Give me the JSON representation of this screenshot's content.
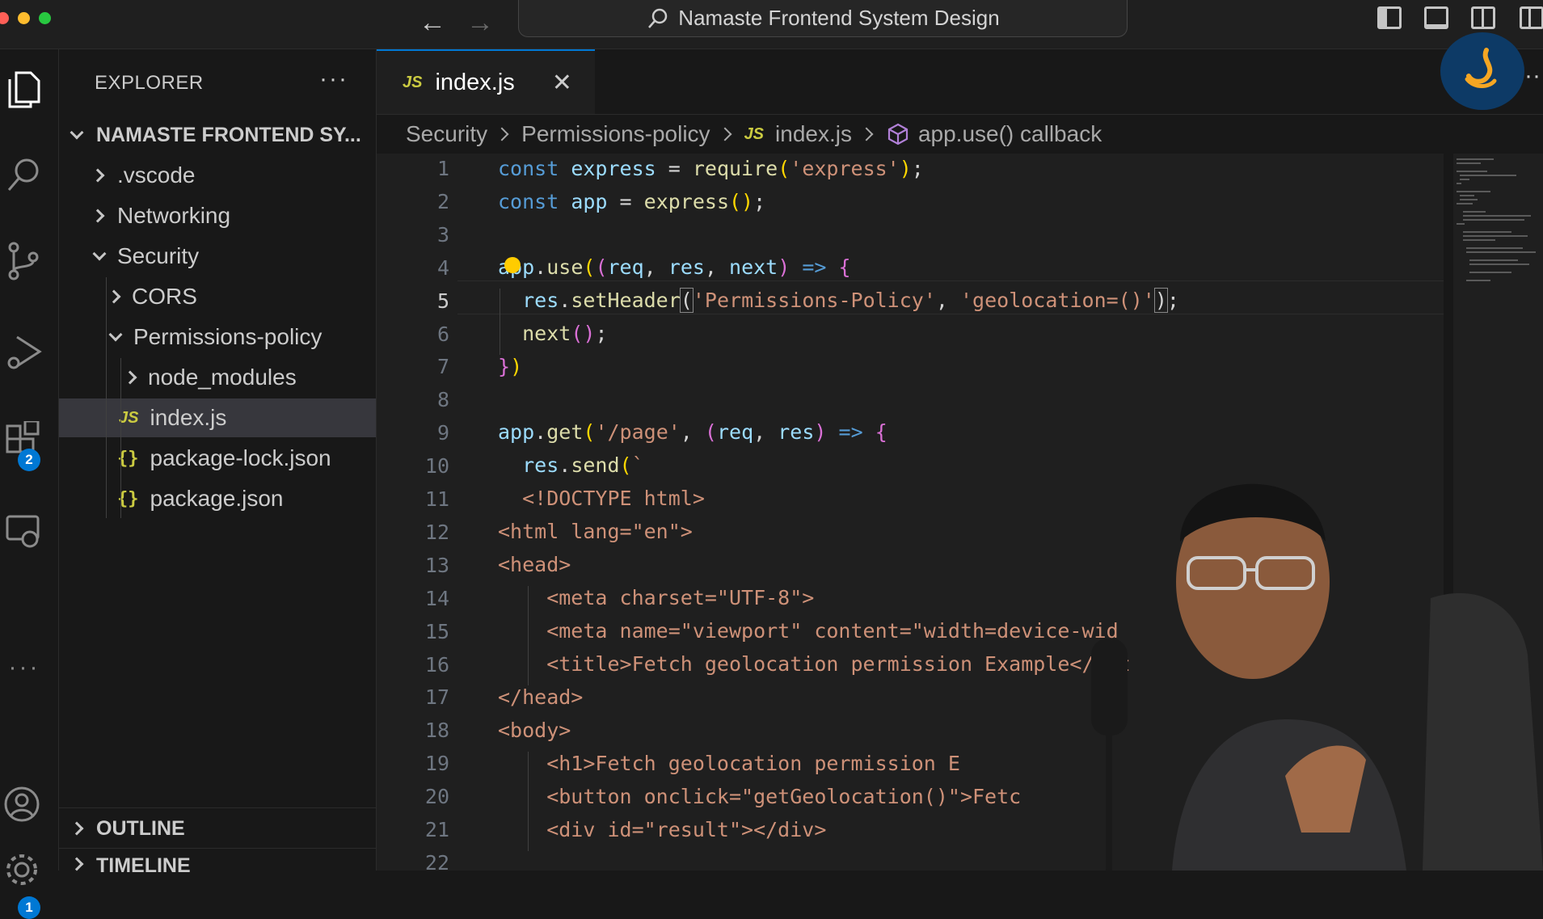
{
  "window": {
    "search_text": "Namaste Frontend System Design",
    "nav_back_icon": "arrow-left-icon",
    "nav_forward_icon": "arrow-right-icon"
  },
  "activity_bar": {
    "items": [
      {
        "name": "explorer",
        "icon": "files-icon"
      },
      {
        "name": "search",
        "icon": "search-icon"
      },
      {
        "name": "source-control",
        "icon": "source-control-icon"
      },
      {
        "name": "run-debug",
        "icon": "run-debug-icon"
      },
      {
        "name": "extensions",
        "icon": "extensions-icon",
        "badge": "2"
      },
      {
        "name": "remote-explorer",
        "icon": "remote-explorer-icon"
      },
      {
        "name": "more",
        "icon": "more-icon"
      },
      {
        "name": "accounts",
        "icon": "account-icon"
      },
      {
        "name": "manage",
        "icon": "gear-icon",
        "badge": "1"
      }
    ]
  },
  "explorer": {
    "title": "EXPLORER",
    "more": "···",
    "project": "NAMASTE FRONTEND SY...",
    "tree": [
      {
        "label": ".vscode",
        "type": "folder",
        "open": false
      },
      {
        "label": "Networking",
        "type": "folder",
        "open": false
      },
      {
        "label": "Security",
        "type": "folder",
        "open": true
      },
      {
        "label": "CORS",
        "type": "folder",
        "open": false
      },
      {
        "label": "Permissions-policy",
        "type": "folder",
        "open": true
      },
      {
        "label": "node_modules",
        "type": "folder",
        "open": false
      },
      {
        "label": "index.js",
        "type": "js",
        "selected": true
      },
      {
        "label": "package-lock.json",
        "type": "json"
      },
      {
        "label": "package.json",
        "type": "json"
      }
    ],
    "outline": "OUTLINE",
    "timeline": "TIMELINE"
  },
  "tab": {
    "icon_label": "JS",
    "label": "index.js",
    "close_icon": "close-icon"
  },
  "breadcrumb": {
    "items": [
      "Security",
      "Permissions-policy",
      "index.js",
      "app.use() callback"
    ],
    "js_label": "JS"
  },
  "editor": {
    "active_line": 5,
    "line_numbers": [
      "1",
      "2",
      "3",
      "4",
      "5",
      "6",
      "7",
      "8",
      "9",
      "10",
      "11",
      "12",
      "13",
      "14",
      "15",
      "16",
      "17",
      "18",
      "19",
      "20",
      "21",
      "22"
    ],
    "lines": [
      "const express = require('express');",
      "const app = express();",
      "",
      "app.use((req, res, next) => {",
      "  res.setHeader('Permissions-Policy', 'geolocation=()');",
      "  next();",
      "})",
      "",
      "app.get('/page', (req, res) => {",
      "  res.send(`",
      "  <!DOCTYPE html>",
      "<html lang=\"en\">",
      "<head>",
      "    <meta charset=\"UTF-8\">",
      "    <meta name=\"viewport\" content=\"width=device-wid",
      "    <title>Fetch geolocation permission Example</tit",
      "</head>",
      "<body>",
      "    <h1>Fetch geolocation permission E",
      "    <button onclick=\"getGeolocation()\">Fetc",
      "    <div id=\"result\"></div>",
      ""
    ]
  },
  "colors": {
    "accent": "#0078d4",
    "keyword": "#569cd6",
    "variable": "#9cdcfe",
    "function": "#dcdcaa",
    "string": "#ce9178",
    "tag": "#f48771",
    "lightbulb": "#ffcc00"
  }
}
